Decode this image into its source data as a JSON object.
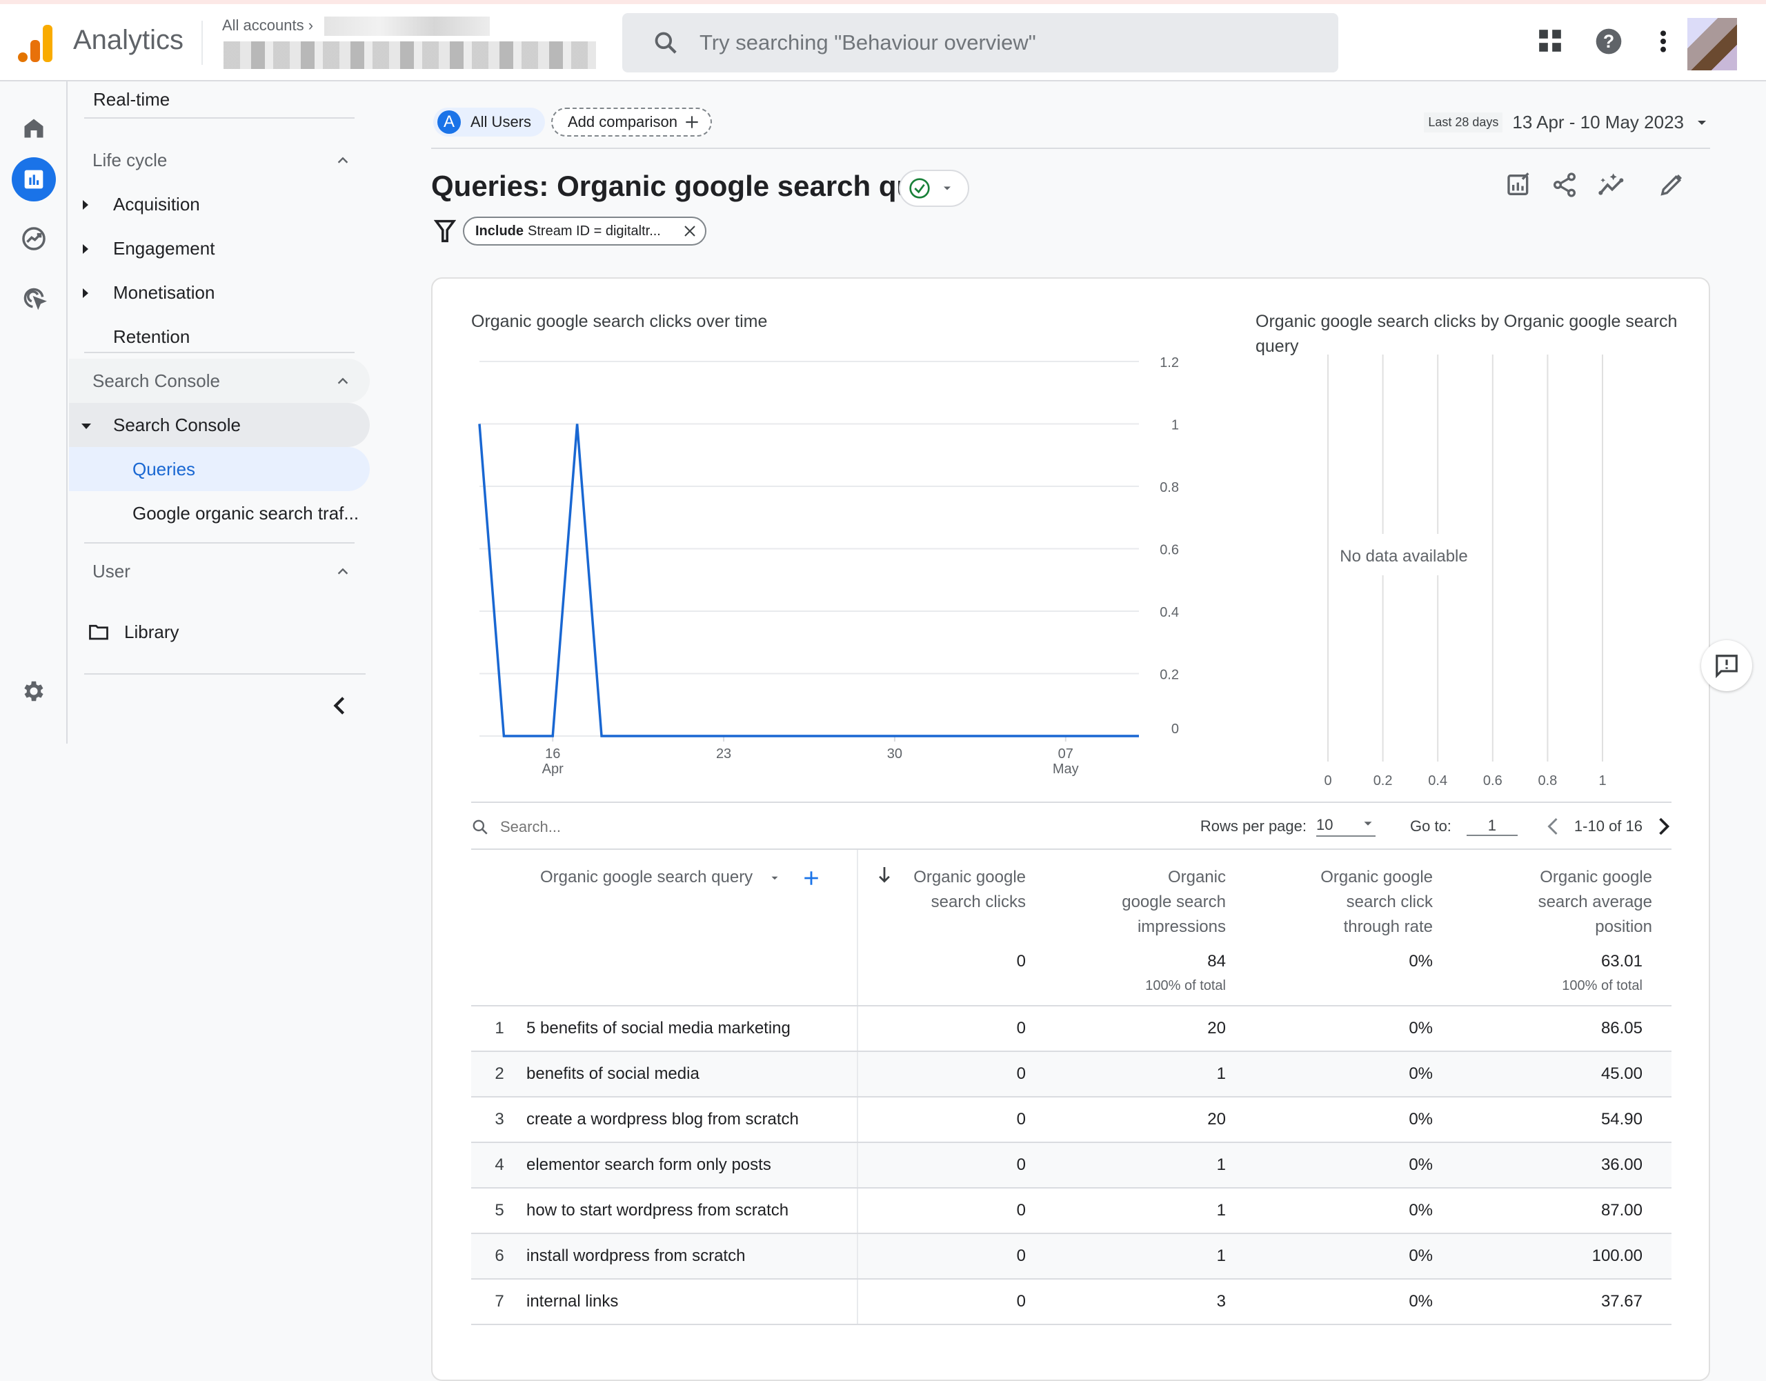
{
  "header": {
    "app_name": "Analytics",
    "breadcrumb": "All accounts",
    "search_placeholder": "Try searching \"Behaviour overview\""
  },
  "sidebar": {
    "realtime": "Real-time",
    "lifecycle_header": "Life cycle",
    "lifecycle_items": [
      "Acquisition",
      "Engagement",
      "Monetisation",
      "Retention"
    ],
    "search_console_header": "Search Console",
    "search_console_group": "Search Console",
    "search_console_items": [
      "Queries",
      "Google organic search traf..."
    ],
    "user_header": "User",
    "library": "Library"
  },
  "comparison": {
    "segment_letter": "A",
    "segment_label": "All Users",
    "add_label": "Add comparison"
  },
  "date": {
    "preset": "Last 28 days",
    "range": "13 Apr - 10 May 2023"
  },
  "report": {
    "title": "Queries: Organic google search query",
    "filter_include": "Include",
    "filter_text": "Stream ID = digitaltr..."
  },
  "colors": {
    "accent": "#1a73e8",
    "line": "#1967d2",
    "selected_bg": "#e8f0fe",
    "status_ok": "#188038"
  },
  "chart_data": [
    {
      "type": "line",
      "title": "Organic google search clicks over time",
      "x": [
        "13 Apr",
        "14 Apr",
        "15 Apr",
        "16 Apr",
        "17 Apr",
        "18 Apr",
        "19 Apr",
        "20 Apr",
        "21 Apr",
        "22 Apr",
        "23 Apr",
        "24 Apr",
        "25 Apr",
        "26 Apr",
        "27 Apr",
        "28 Apr",
        "29 Apr",
        "30 Apr",
        "01 May",
        "02 May",
        "03 May",
        "04 May",
        "05 May",
        "06 May",
        "07 May",
        "08 May",
        "09 May",
        "10 May"
      ],
      "series": [
        {
          "name": "Organic google search clicks",
          "values": [
            1,
            0,
            0,
            0,
            1,
            0,
            0,
            0,
            0,
            0,
            0,
            0,
            0,
            0,
            0,
            0,
            0,
            0,
            0,
            0,
            0,
            0,
            0,
            0,
            0,
            0,
            0,
            0
          ]
        }
      ],
      "x_ticks": [
        {
          "index": 3,
          "label": "16",
          "sub": "Apr"
        },
        {
          "index": 10,
          "label": "23",
          "sub": ""
        },
        {
          "index": 17,
          "label": "30",
          "sub": ""
        },
        {
          "index": 24,
          "label": "07",
          "sub": "May"
        }
      ],
      "y_ticks": [
        "0",
        "0.2",
        "0.4",
        "0.6",
        "0.8",
        "1",
        "1.2"
      ],
      "ylim": [
        0,
        1.2
      ],
      "axis_side": "right",
      "grid": true
    },
    {
      "type": "bar",
      "title": "Organic google search clicks by Organic google search query",
      "categories": [],
      "values": [],
      "x_ticks": [
        "0",
        "0.2",
        "0.4",
        "0.6",
        "0.8",
        "1"
      ],
      "xlim": [
        0,
        1
      ],
      "empty_message": "No data available",
      "grid": true
    }
  ],
  "table": {
    "search_placeholder": "Search...",
    "rows_per_page_label": "Rows per page:",
    "rows_per_page": "10",
    "goto_label": "Go to:",
    "goto_value": "1",
    "page_info": "1-10 of 16",
    "dimension_header": "Organic google search query",
    "columns": [
      {
        "label": "Organic google search clicks",
        "sorted": true
      },
      {
        "label": "Organic google search impressions"
      },
      {
        "label": "Organic google search click through rate"
      },
      {
        "label": "Organic google search average position"
      }
    ],
    "totals": {
      "values": [
        "0",
        "84",
        "0%",
        "63.01"
      ],
      "pct": [
        "",
        "100% of total",
        "",
        "100% of total"
      ]
    },
    "rows": [
      {
        "n": "1",
        "query": "5 benefits of social media marketing",
        "clicks": "0",
        "impressions": "20",
        "ctr": "0%",
        "position": "86.05"
      },
      {
        "n": "2",
        "query": "benefits of social media",
        "clicks": "0",
        "impressions": "1",
        "ctr": "0%",
        "position": "45.00"
      },
      {
        "n": "3",
        "query": "create a wordpress blog from scratch",
        "clicks": "0",
        "impressions": "20",
        "ctr": "0%",
        "position": "54.90"
      },
      {
        "n": "4",
        "query": "elementor search form only posts",
        "clicks": "0",
        "impressions": "1",
        "ctr": "0%",
        "position": "36.00"
      },
      {
        "n": "5",
        "query": "how to start wordpress from scratch",
        "clicks": "0",
        "impressions": "1",
        "ctr": "0%",
        "position": "87.00"
      },
      {
        "n": "6",
        "query": "install wordpress from scratch",
        "clicks": "0",
        "impressions": "1",
        "ctr": "0%",
        "position": "100.00"
      },
      {
        "n": "7",
        "query": "internal links",
        "clicks": "0",
        "impressions": "3",
        "ctr": "0%",
        "position": "37.67"
      }
    ]
  }
}
